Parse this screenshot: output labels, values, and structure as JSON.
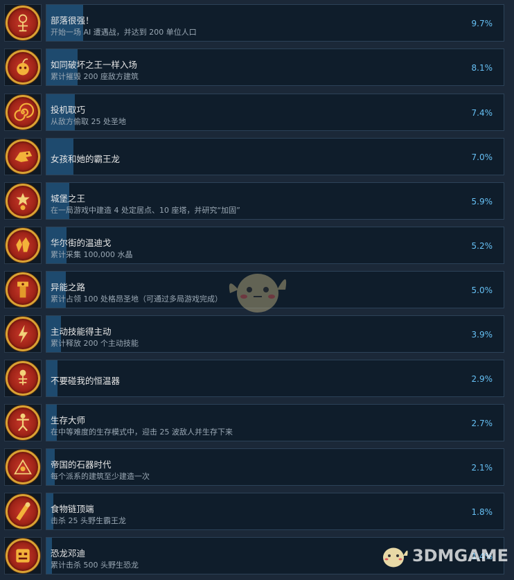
{
  "achievements": [
    {
      "title": "部落很强！",
      "desc": "开始一场 AI 遭遇战，并达到 200 单位人口",
      "pct": "9.7%",
      "pct_value": 9.7,
      "icon": "tribal-glyph-icon"
    },
    {
      "title": "如同破坏之王一样入场",
      "desc": "累计摧毁 200 座敌方建筑",
      "pct": "8.1%",
      "pct_value": 8.1,
      "icon": "bomb-icon"
    },
    {
      "title": "投机取巧",
      "desc": "从敌方偷取 25 处圣地",
      "pct": "7.4%",
      "pct_value": 7.4,
      "icon": "spiral-icon"
    },
    {
      "title": "女孩和她的霸王龙",
      "desc": "",
      "pct": "7.0%",
      "pct_value": 7.0,
      "icon": "trex-icon"
    },
    {
      "title": "城堡之王",
      "desc": "在一局游戏中建造 4 处定居点、10 座塔，并研究“加固”",
      "pct": "5.9%",
      "pct_value": 5.9,
      "icon": "castle-king-icon"
    },
    {
      "title": "华尔街的温迪戈",
      "desc": "累计采集 100,000 水晶",
      "pct": "5.2%",
      "pct_value": 5.2,
      "icon": "crystal-icon"
    },
    {
      "title": "异能之路",
      "desc": "累计占领 100 处格昂圣地（可通过多局游戏完成）",
      "pct": "5.0%",
      "pct_value": 5.0,
      "icon": "totem-icon"
    },
    {
      "title": "主动技能得主动",
      "desc": "累计释放 200 个主动技能",
      "pct": "3.9%",
      "pct_value": 3.9,
      "icon": "lightning-icon"
    },
    {
      "title": "不要碰我的恒温器",
      "desc": "",
      "pct": "2.9%",
      "pct_value": 2.9,
      "icon": "thermostat-icon"
    },
    {
      "title": "生存大师",
      "desc": "在中等难度的生存模式中，迎击 25 波敌人并生存下来",
      "pct": "2.7%",
      "pct_value": 2.7,
      "icon": "survivor-icon"
    },
    {
      "title": "帝国的石器时代",
      "desc": "每个派系的建筑至少建造一次",
      "pct": "2.1%",
      "pct_value": 2.1,
      "icon": "stone-age-icon"
    },
    {
      "title": "食物链顶端",
      "desc": "击杀 25 头野生霸王龙",
      "pct": "1.8%",
      "pct_value": 1.8,
      "icon": "food-chain-icon"
    },
    {
      "title": "恐龙邓迪",
      "desc": "累计击杀 500 头野生恐龙",
      "pct": "1.4%",
      "pct_value": 1.4,
      "icon": "dino-mask-icon"
    }
  ],
  "watermark": {
    "text": "3DMGAME"
  },
  "colors": {
    "background": "#1b2838",
    "card": "#0f1d2b",
    "fill": "#1e4a6e",
    "percent": "#66c0f4",
    "badge_red": "#b02a1c",
    "badge_gold": "#d9a233"
  }
}
